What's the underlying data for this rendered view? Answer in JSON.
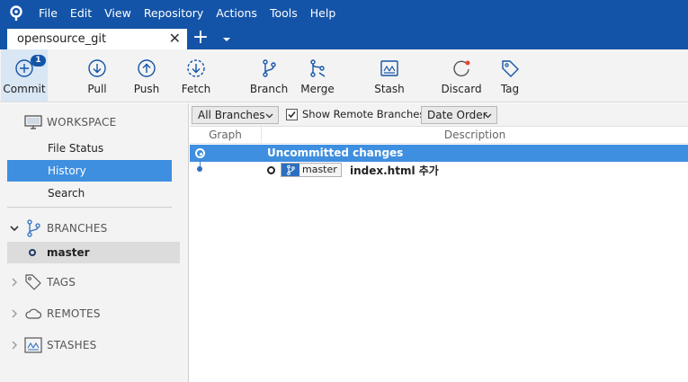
{
  "menu": [
    "File",
    "Edit",
    "View",
    "Repository",
    "Actions",
    "Tools",
    "Help"
  ],
  "tab": {
    "title": "opensource_git",
    "close": "✕",
    "add": "+"
  },
  "toolbar": {
    "commit": "Commit",
    "commit_badge": "1",
    "pull": "Pull",
    "push": "Push",
    "fetch": "Fetch",
    "branch": "Branch",
    "merge": "Merge",
    "stash": "Stash",
    "discard": "Discard",
    "tag": "Tag"
  },
  "sidebar": {
    "workspace": "WORKSPACE",
    "items": [
      "File Status",
      "History",
      "Search"
    ],
    "branches": "BRANCHES",
    "branch_item": "master",
    "tags": "TAGS",
    "remotes": "REMOTES",
    "stashes": "STASHES"
  },
  "filters": {
    "branches": "All Branches",
    "show_remote": "Show Remote Branches",
    "order": "Date Order"
  },
  "columns": {
    "graph": "Graph",
    "description": "Description"
  },
  "rows": {
    "uncommitted": "Uncommitted changes",
    "branch_tag": "master",
    "commit_message": "index.html 추가"
  },
  "colors": {
    "accent": "#1454a8",
    "selection": "#3f8fe0",
    "discard_dot": "#e8452e"
  }
}
